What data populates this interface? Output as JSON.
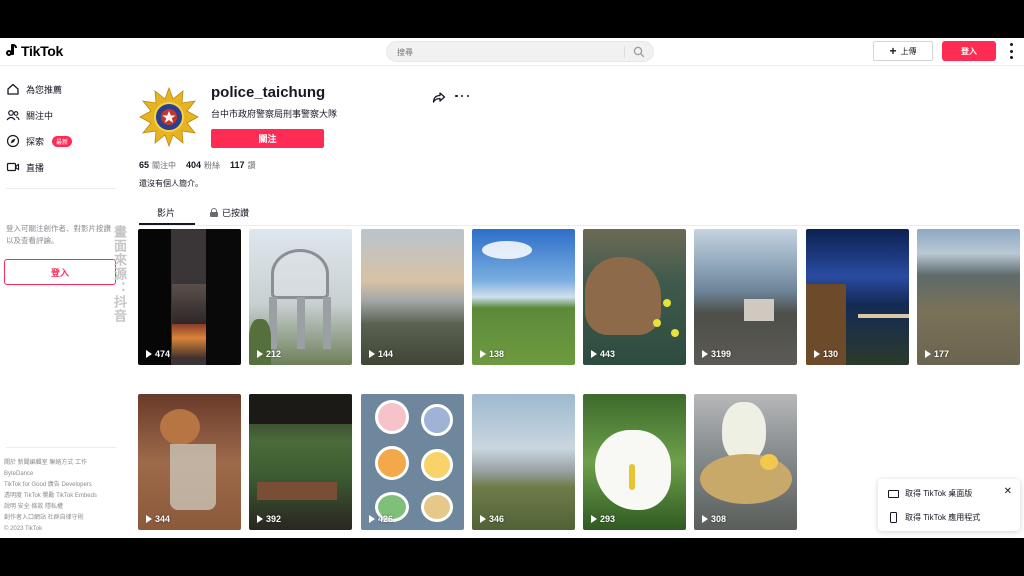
{
  "header": {
    "logo_text": "TikTok",
    "search_placeholder": "搜尋",
    "upload_label": "上傳",
    "login_label": "登入"
  },
  "sidebar": {
    "nav": [
      {
        "label": "為您推薦",
        "icon": "home-icon"
      },
      {
        "label": "關注中",
        "icon": "users-icon"
      },
      {
        "label": "探索",
        "icon": "compass-icon",
        "badge": "最新"
      },
      {
        "label": "直播",
        "icon": "live-icon"
      }
    ],
    "prompt": "登入可關注創作者、對影片按讚以及查看評論。",
    "login_label": "登入",
    "watermark": "畫面來源：抖音",
    "footer": [
      "關於  新聞編輯室  聯絡方式  工作",
      "ByteDance",
      "TikTok for Good  廣告  Developers",
      "透明度  TikTok 獎勵  TikTok Embeds",
      "說明  安全  條款  隱私權",
      "創作者入口網站  社群自律守則",
      "© 2023 TikTok"
    ]
  },
  "profile": {
    "username": "police_taichung",
    "subtitle": "台中市政府警察局刑事警察大隊",
    "follow_label": "關注",
    "stats": [
      {
        "value": "65",
        "label": "關注中"
      },
      {
        "value": "404",
        "label": "粉絲"
      },
      {
        "value": "117",
        "label": "讚"
      }
    ],
    "bio": "還沒有個人簡介。",
    "tabs": {
      "videos": "影片",
      "liked": "已按讚"
    }
  },
  "videos": [
    {
      "views": "474",
      "scene": "vertical-street"
    },
    {
      "views": "212",
      "scene": "tower"
    },
    {
      "views": "144",
      "scene": "sunset-coast"
    },
    {
      "views": "138",
      "scene": "meadow-sky"
    },
    {
      "views": "443",
      "scene": "capybara"
    },
    {
      "views": "3199",
      "scene": "sea-village"
    },
    {
      "views": "130",
      "scene": "night-balcony"
    },
    {
      "views": "177",
      "scene": "rocky-shore"
    },
    {
      "views": "344",
      "scene": "bear-cup"
    },
    {
      "views": "392",
      "scene": "restaurant"
    },
    {
      "views": "426",
      "scene": "cartoon-wall"
    },
    {
      "views": "346",
      "scene": "coast-field"
    },
    {
      "views": "293",
      "scene": "calla-lily"
    },
    {
      "views": "308",
      "scene": "bear-hotpot"
    }
  ],
  "app_popup": {
    "pc_label": "取得 TikTok 桌面版",
    "app_label": "取得 TikTok 應用程式"
  },
  "colors": {
    "brand_red": "#fe2c55",
    "text": "#161823"
  }
}
